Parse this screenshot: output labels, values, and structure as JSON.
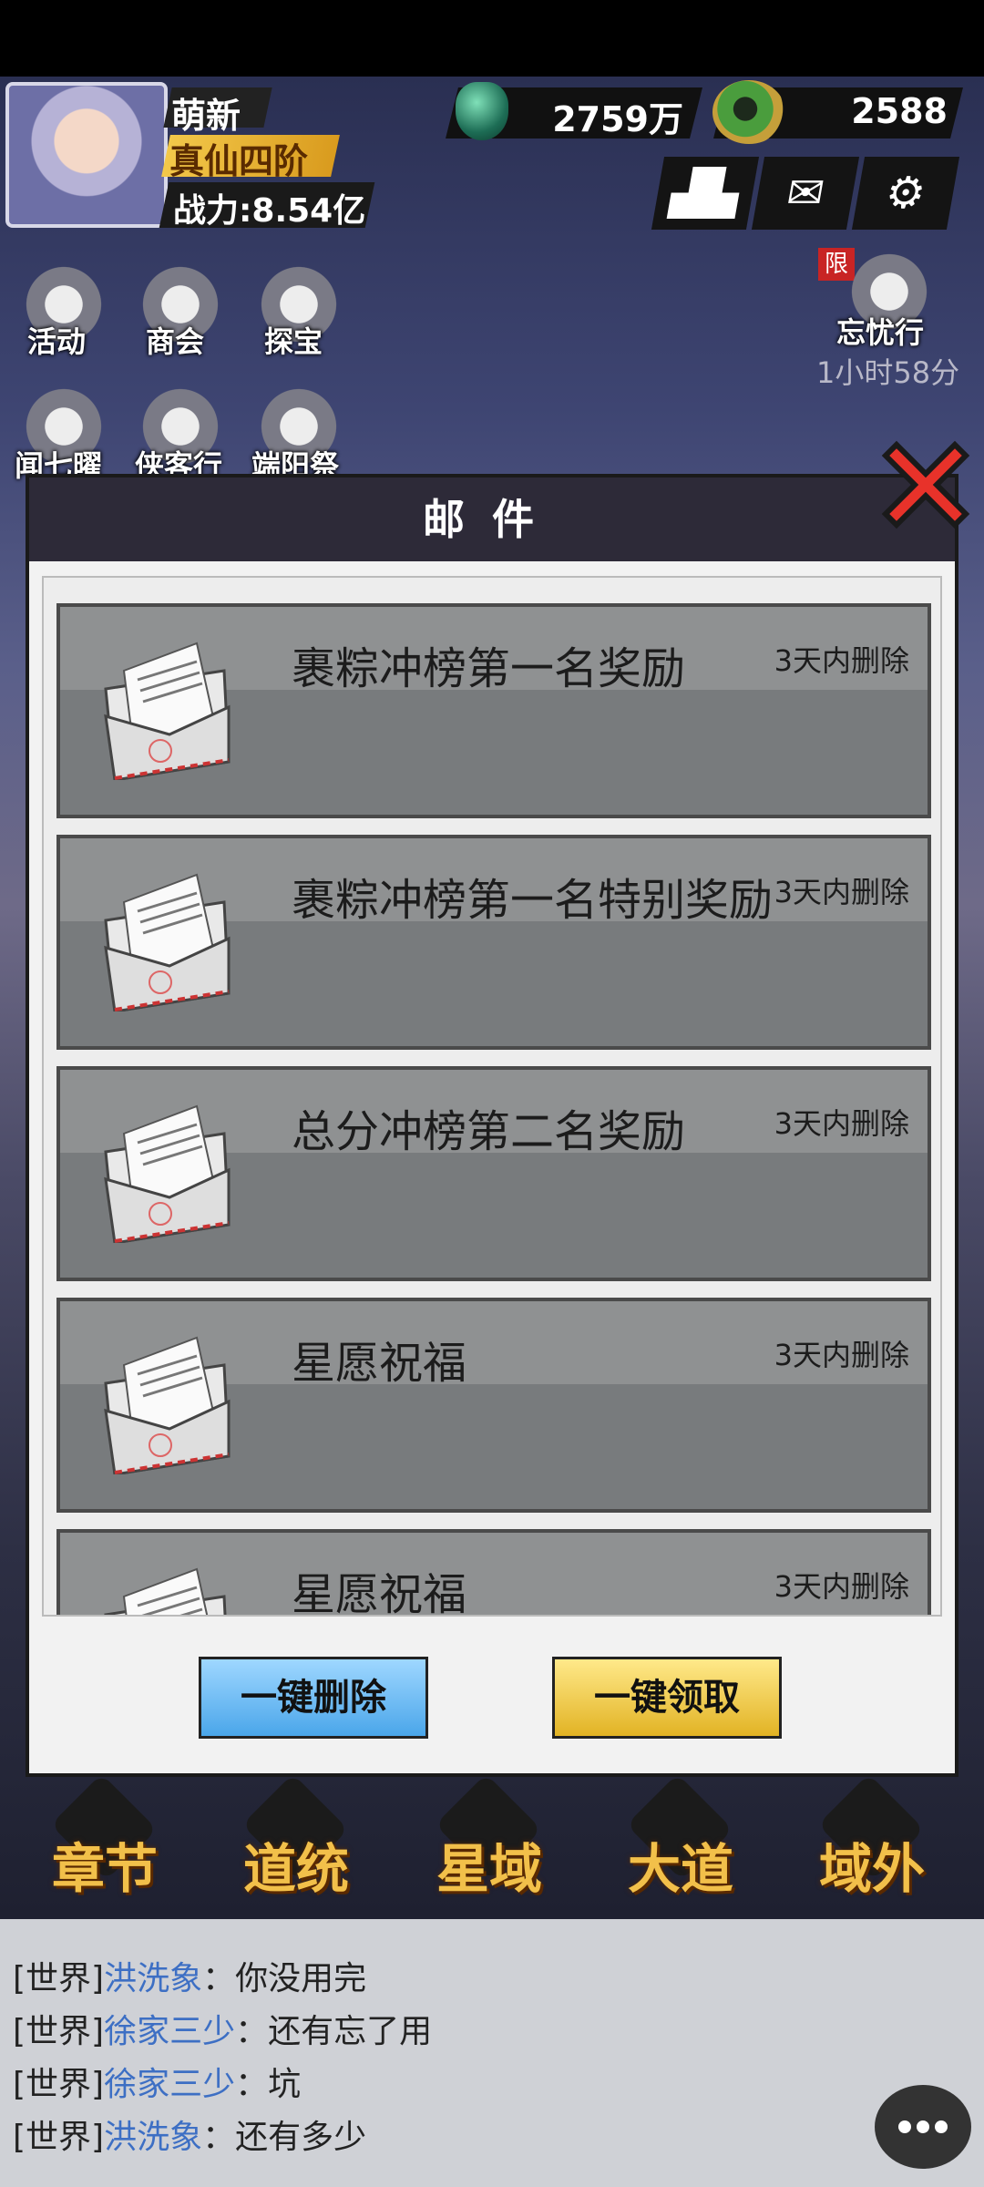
{
  "player": {
    "name": "萌新",
    "rank": "真仙四阶",
    "power": "战力:8.54亿"
  },
  "currency": {
    "gems": "2759万",
    "jade": "2588"
  },
  "left_menu": {
    "row1": [
      "活动",
      "商会",
      "探宝"
    ],
    "row2": [
      "闻七曜",
      "侠客行",
      "端阳祭"
    ]
  },
  "event": {
    "tag": "限",
    "name": "忘忧行",
    "timer": "1小时58分"
  },
  "mail_dialog": {
    "title": "邮件",
    "items": [
      {
        "title": "裹粽冲榜第一名奖励",
        "expire": "3天内删除"
      },
      {
        "title": "裹粽冲榜第一名特别奖励",
        "expire": "3天内删除"
      },
      {
        "title": "总分冲榜第二名奖励",
        "expire": "3天内删除"
      },
      {
        "title": "星愿祝福",
        "expire": "3天内删除"
      },
      {
        "title": "星愿祝福",
        "expire": "3天内删除"
      }
    ],
    "delete_all_label": "一键删除",
    "claim_all_label": "一键领取"
  },
  "bottom_nav": [
    "章节",
    "道统",
    "星域",
    "大道",
    "域外"
  ],
  "chat": [
    {
      "channel": "[世界]",
      "name": "洪洗象",
      "message": "：你没用完"
    },
    {
      "channel": "[世界]",
      "name": "徐家三少",
      "message": "：还有忘了用"
    },
    {
      "channel": "[世界]",
      "name": "徐家三少",
      "message": "：坑"
    },
    {
      "channel": "[世界]",
      "name": "洪洗象",
      "message": "：还有多少"
    }
  ]
}
